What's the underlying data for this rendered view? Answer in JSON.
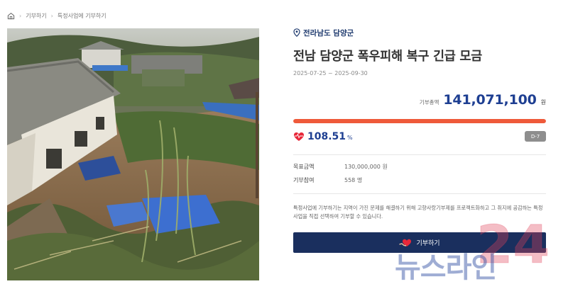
{
  "breadcrumb": {
    "home_icon": "home-icon",
    "items": [
      "기부하기",
      "특정사업에 기부하기"
    ]
  },
  "campaign": {
    "location": "전라남도 담양군",
    "title": "전남 담양군 폭우피해 복구 긴급 모금",
    "dates": "2025-07-25 ~ 2025-09-30",
    "total_label": "기부총액",
    "total_amount": "141,071,100",
    "total_unit": "원",
    "progress_fraction": 1.0,
    "percent": "108.51",
    "percent_sign": "%",
    "dday": "D-7",
    "goal_label": "목표금액",
    "goal_value": "130,000,000 원",
    "donors_label": "기부참여",
    "donors_value": "558 명",
    "description": "특정사업에 기부하기는 지역이 가진 문제를 해결하기 위해 고향사랑기부제를 프로젝트화하고 그 취지에 공감하는 특정사업을 직접 선택하여 기부할 수 있습니다.",
    "donate_button": "기부하기"
  },
  "watermark": {
    "text": "뉴스라인",
    "number": "24"
  },
  "colors": {
    "brand_navy": "#1e3f92",
    "button_navy": "#1a2f5e",
    "progress": "#ef5a3a",
    "heart": "#e8283a"
  }
}
